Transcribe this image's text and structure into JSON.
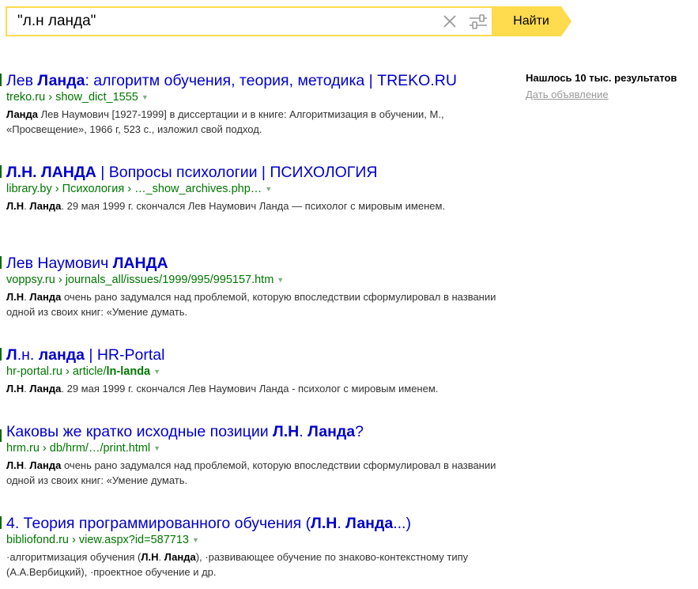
{
  "search": {
    "query": "\"л.н ланда\"",
    "find_label": "Найти"
  },
  "sidebar": {
    "found": "Нашлось 10 тыс. результатов",
    "ad_link": "Дать объявление"
  },
  "results": [
    {
      "title": [
        [
          "Лев ",
          false
        ],
        [
          "Ланда",
          true
        ],
        [
          ": алгоритм обучения, теория, методика | TREKO.RU",
          false
        ]
      ],
      "path": [
        [
          "treko.ru",
          false
        ],
        [
          " › ",
          false
        ],
        [
          "show_dict_1555",
          false
        ]
      ],
      "snippet": [
        [
          "Ланда",
          true
        ],
        [
          " Лев Наумович [1927-1999] в диссертации и в книге: Алгоритмизация в обучении, М., «Просвещение», 1966 г, 523 с., изложил свой подход.",
          false
        ]
      ]
    },
    {
      "title": [
        [
          "Л.Н. ЛАНДА",
          true
        ],
        [
          " | Вопросы психологии | ПСИХОЛОГИЯ",
          false
        ]
      ],
      "path": [
        [
          "library.by",
          false
        ],
        [
          " › ",
          false
        ],
        [
          "Психология",
          false
        ],
        [
          " › ",
          false
        ],
        [
          "…_show_archives.php…",
          false
        ]
      ],
      "snippet": [
        [
          "Л.Н",
          true
        ],
        [
          ". ",
          false
        ],
        [
          "Ланда",
          true
        ],
        [
          ". 29 мая 1999 г. скончался Лев Наумович Ланда — психолог с мировым именем.",
          false
        ]
      ]
    },
    {
      "title": [
        [
          "Лев Наумович ",
          false
        ],
        [
          "ЛАНДА",
          true
        ]
      ],
      "path": [
        [
          "voppsy.ru",
          false
        ],
        [
          " › ",
          false
        ],
        [
          "journals_all/issues/1999/995/995157.htm",
          false
        ]
      ],
      "snippet": [
        [
          "Л.Н",
          true
        ],
        [
          ". ",
          false
        ],
        [
          "Ланда",
          true
        ],
        [
          " очень рано задумался над проблемой, которую впоследствии сформулировал в названии одной из своих книг: «Умение думать.",
          false
        ]
      ]
    },
    {
      "title": [
        [
          "Л",
          true
        ],
        [
          ".н. ",
          false
        ],
        [
          "ланда",
          true
        ],
        [
          " | HR-Portal",
          false
        ]
      ],
      "path": [
        [
          "hr-portal.ru",
          false
        ],
        [
          " › ",
          false
        ],
        [
          "article/",
          false
        ],
        [
          "ln-landa",
          true
        ]
      ],
      "snippet": [
        [
          "Л.Н",
          true
        ],
        [
          ". ",
          false
        ],
        [
          "Ланда",
          true
        ],
        [
          ". 29 мая 1999 г. скончался Лев Наумович Ланда - психолог с мировым именем.",
          false
        ]
      ]
    },
    {
      "title": [
        [
          "Каковы же кратко исходные позиции ",
          false
        ],
        [
          "Л.Н",
          true
        ],
        [
          ". ",
          false
        ],
        [
          "Ланда",
          true
        ],
        [
          "?",
          false
        ]
      ],
      "path": [
        [
          "hrm.ru",
          false
        ],
        [
          " › ",
          false
        ],
        [
          "db/hrm/…/print.html",
          false
        ]
      ],
      "snippet": [
        [
          "Л.Н",
          true
        ],
        [
          ". ",
          false
        ],
        [
          "Ланда",
          true
        ],
        [
          " очень рано задумался над проблемой, которую впоследствии сформулировал в названии одной из своих книг: «Умение думать.",
          false
        ]
      ]
    },
    {
      "title": [
        [
          "4. Теория программированного обучения (",
          false
        ],
        [
          "Л.Н",
          true
        ],
        [
          ". ",
          false
        ],
        [
          "Ланда",
          true
        ],
        [
          "...)",
          false
        ]
      ],
      "path": [
        [
          "bibliofond.ru",
          false
        ],
        [
          " › ",
          false
        ],
        [
          "view.aspx?id=587713",
          false
        ]
      ],
      "snippet": [
        [
          "·алгоритмизация обучения (",
          false
        ],
        [
          "Л.Н",
          true
        ],
        [
          ". ",
          false
        ],
        [
          "Ланда",
          true
        ],
        [
          "), ·развивающее обучение по знаково-контекстному типу (А.А.Вербицкий), ·проектное обучение и др.",
          false
        ]
      ]
    }
  ]
}
